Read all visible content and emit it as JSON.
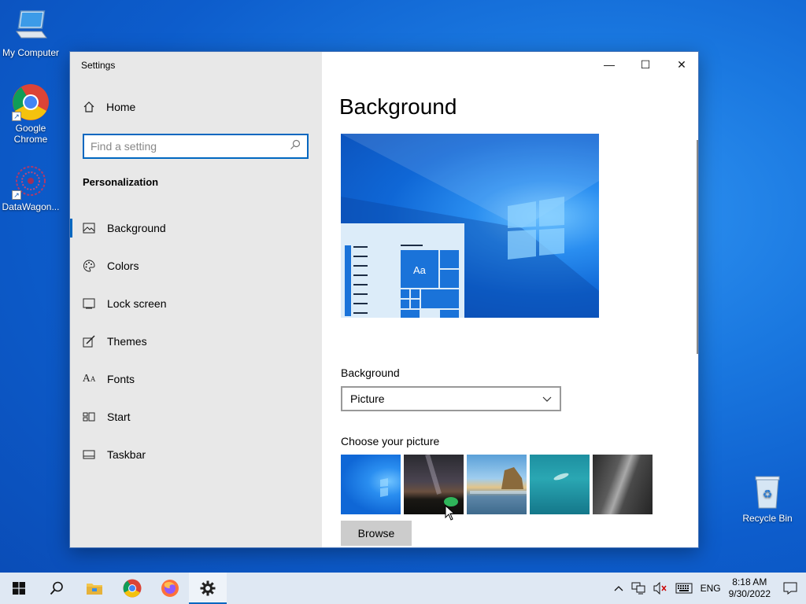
{
  "desktop": {
    "icons": [
      {
        "label": "My Computer"
      },
      {
        "label": "Google Chrome"
      },
      {
        "label": "DataWagon..."
      },
      {
        "label": "Recycle Bin"
      }
    ]
  },
  "window": {
    "title": "Settings",
    "home_label": "Home",
    "search_placeholder": "Find a setting",
    "section_title": "Personalization",
    "nav": [
      {
        "label": "Background",
        "icon": "picture-icon",
        "active": true
      },
      {
        "label": "Colors",
        "icon": "palette-icon"
      },
      {
        "label": "Lock screen",
        "icon": "lock-screen-icon"
      },
      {
        "label": "Themes",
        "icon": "brush-icon"
      },
      {
        "label": "Fonts",
        "icon": "font-icon"
      },
      {
        "label": "Start",
        "icon": "start-icon"
      },
      {
        "label": "Taskbar",
        "icon": "taskbar-icon"
      }
    ],
    "caption": {
      "minimize": "—",
      "maximize": "☐",
      "close": "✕"
    },
    "content": {
      "page_title": "Background",
      "preview_tile_text": "Aa",
      "background_label": "Background",
      "background_value": "Picture",
      "choose_label": "Choose your picture",
      "browse_label": "Browse"
    }
  },
  "taskbar": {
    "apps": [
      "windows-start-icon",
      "search-icon",
      "file-explorer-icon",
      "chrome-icon",
      "firefox-icon",
      "settings-icon"
    ],
    "active_app": "settings-icon",
    "language": "ENG",
    "time": "8:18 AM",
    "date": "9/30/2022"
  },
  "colors": {
    "accent": "#0067c0"
  }
}
